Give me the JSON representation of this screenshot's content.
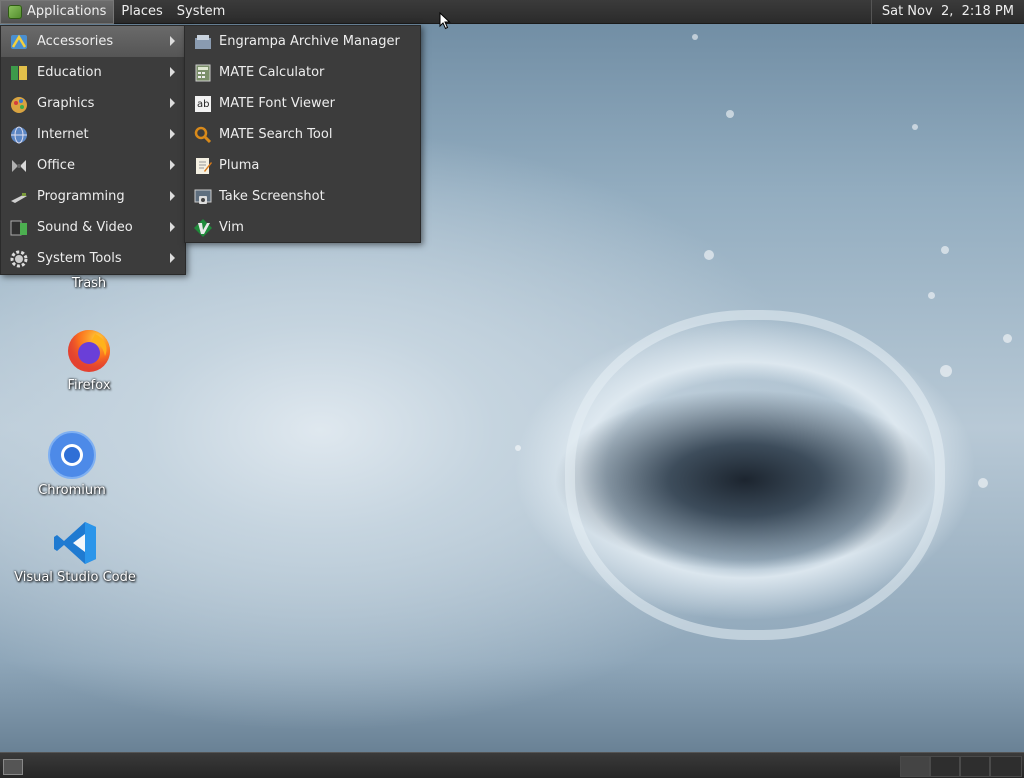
{
  "top_panel": {
    "menus": [
      "Applications",
      "Places",
      "System"
    ],
    "clock": "Sat Nov  2,  2:18 PM"
  },
  "apps_menu": {
    "items": [
      {
        "label": "Accessories",
        "icon": "accessories-icon"
      },
      {
        "label": "Education",
        "icon": "education-icon"
      },
      {
        "label": "Graphics",
        "icon": "graphics-icon"
      },
      {
        "label": "Internet",
        "icon": "internet-icon"
      },
      {
        "label": "Office",
        "icon": "office-icon"
      },
      {
        "label": "Programming",
        "icon": "programming-icon"
      },
      {
        "label": "Sound & Video",
        "icon": "sound-video-icon"
      },
      {
        "label": "System Tools",
        "icon": "system-tools-icon"
      }
    ]
  },
  "accessories_menu": {
    "items": [
      {
        "label": "Engrampa Archive Manager",
        "icon": "archive-icon"
      },
      {
        "label": "MATE Calculator",
        "icon": "calculator-icon"
      },
      {
        "label": "MATE Font Viewer",
        "icon": "font-viewer-icon"
      },
      {
        "label": "MATE Search Tool",
        "icon": "search-tool-icon"
      },
      {
        "label": "Pluma",
        "icon": "text-editor-icon"
      },
      {
        "label": "Take Screenshot",
        "icon": "screenshot-icon"
      },
      {
        "label": "Vim",
        "icon": "vim-icon"
      }
    ]
  },
  "desktop": {
    "icons": [
      {
        "label": "Trash",
        "icon": "trash-icon"
      },
      {
        "label": "Firefox",
        "icon": "firefox-icon"
      },
      {
        "label": "Chromium",
        "icon": "chromium-icon"
      },
      {
        "label": "Visual Studio Code",
        "icon": "vscode-icon"
      }
    ]
  },
  "colors": {
    "panel": "#2b2b2b",
    "menu_bg": "#3c3c3c",
    "menu_active": "#5e5e5e"
  }
}
